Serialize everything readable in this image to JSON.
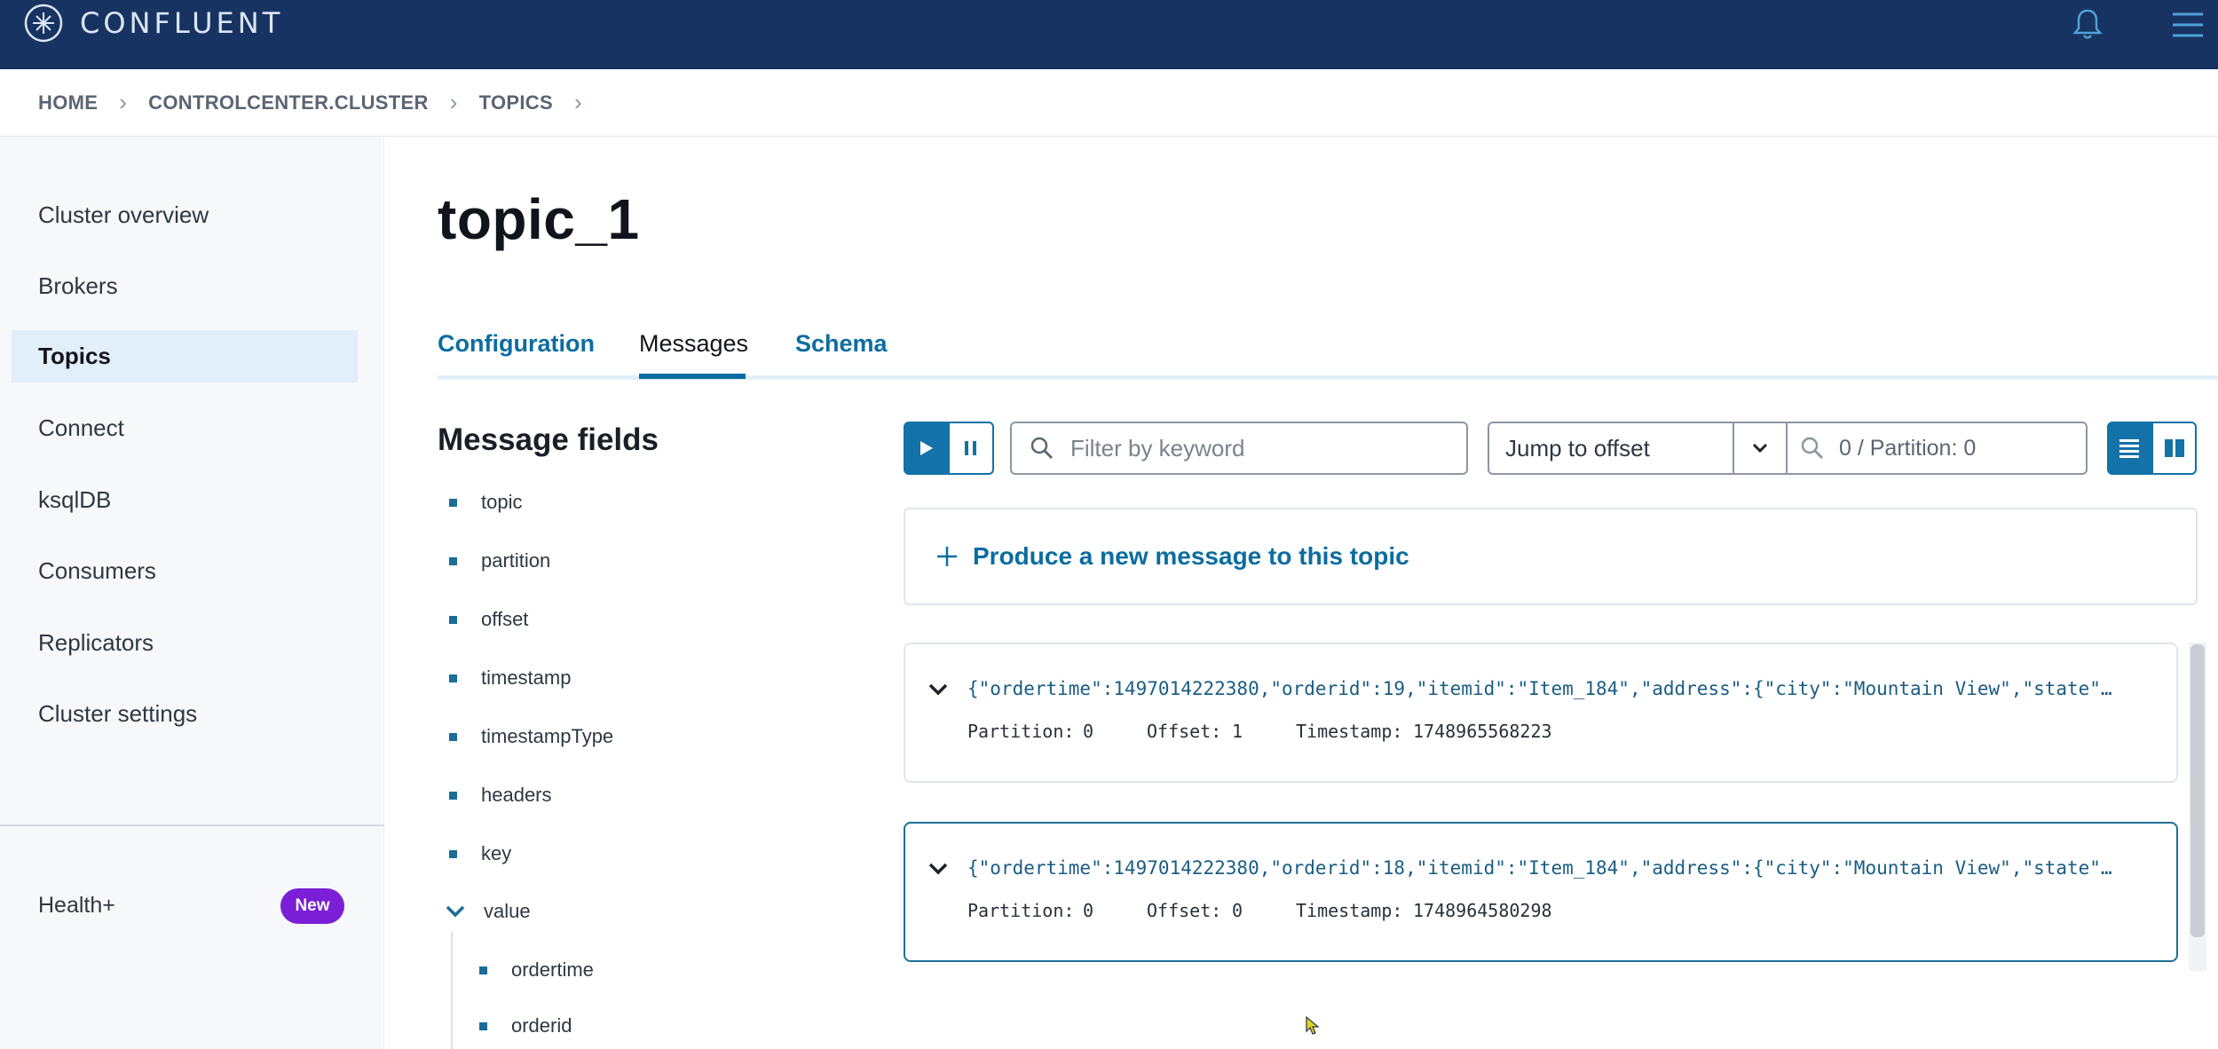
{
  "brand": {
    "name": "CONFLUENT"
  },
  "breadcrumb": [
    "HOME",
    "CONTROLCENTER.CLUSTER",
    "TOPICS"
  ],
  "sidebar": {
    "items": [
      {
        "label": "Cluster overview"
      },
      {
        "label": "Brokers"
      },
      {
        "label": "Topics",
        "active": true
      },
      {
        "label": "Connect"
      },
      {
        "label": "ksqlDB"
      },
      {
        "label": "Consumers"
      },
      {
        "label": "Replicators"
      },
      {
        "label": "Cluster settings"
      }
    ],
    "health_label": "Health+",
    "health_badge": "New"
  },
  "page": {
    "title": "topic_1"
  },
  "tabs": [
    {
      "label": "Configuration"
    },
    {
      "label": "Messages",
      "active": true
    },
    {
      "label": "Schema"
    }
  ],
  "message_fields": {
    "title": "Message fields",
    "items": [
      "topic",
      "partition",
      "offset",
      "timestamp",
      "timestampType",
      "headers",
      "key",
      "value"
    ],
    "value_children": [
      "ordertime",
      "orderid"
    ]
  },
  "toolbar": {
    "search_placeholder": "Filter by keyword",
    "jump_label": "Jump to offset",
    "offset_placeholder": "0 / Partition: 0"
  },
  "produce": {
    "label": "Produce a new message to this topic"
  },
  "messages": [
    {
      "json": "{\"ordertime\":1497014222380,\"orderid\":19,\"itemid\":\"Item_184\",\"address\":{\"city\":\"Mountain View\",\"state\"…",
      "partition_label": "Partition:",
      "partition": "0",
      "offset_label": "Offset:",
      "offset": "1",
      "timestamp_label": "Timestamp:",
      "timestamp": "1748965568223"
    },
    {
      "json": "{\"ordertime\":1497014222380,\"orderid\":18,\"itemid\":\"Item_184\",\"address\":{\"city\":\"Mountain View\",\"state\"…",
      "partition_label": "Partition:",
      "partition": "0",
      "offset_label": "Offset:",
      "offset": "0",
      "timestamp_label": "Timestamp:",
      "timestamp": "1748964580298"
    }
  ],
  "colors": {
    "topbar": "#173361",
    "accent": "#1372a7",
    "badge": "#7a1fd6"
  }
}
